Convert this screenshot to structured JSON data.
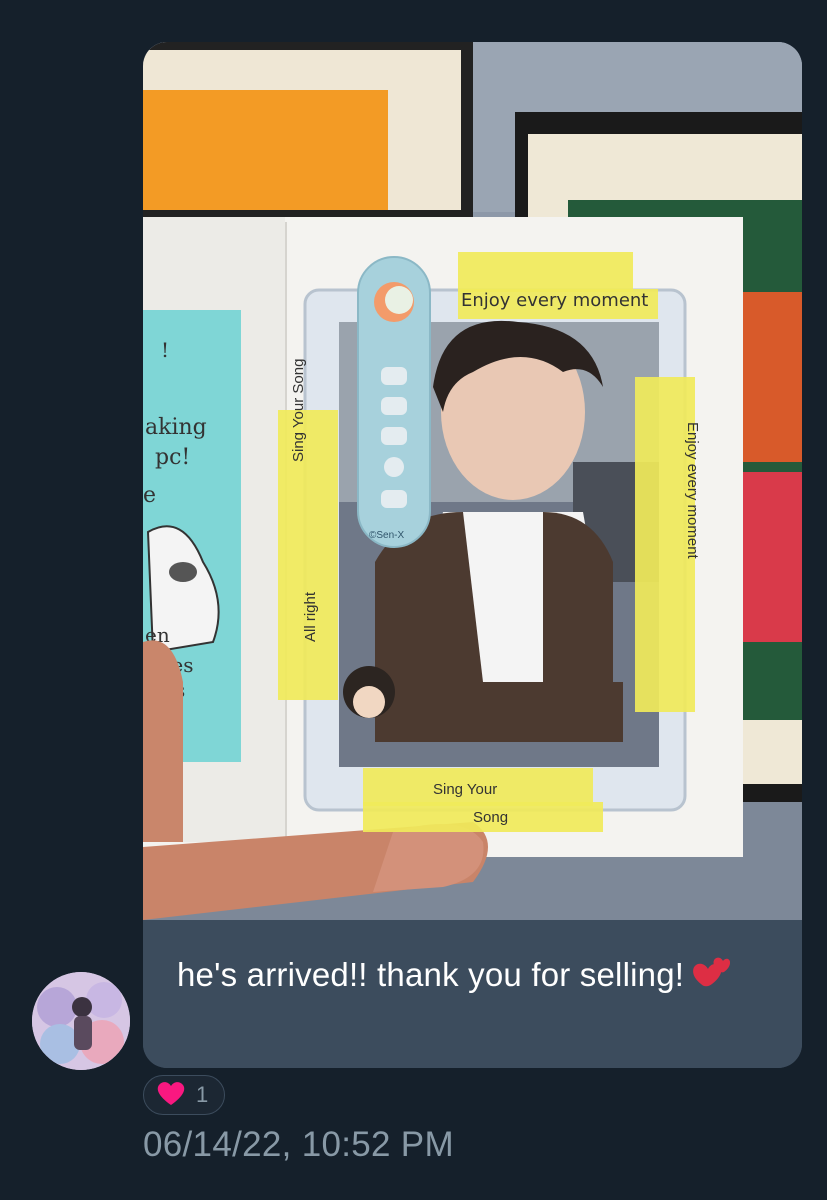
{
  "message": {
    "caption": "he's arrived!! thank you for selling!",
    "caption_emoji": "two-hearts-icon",
    "photo": {
      "tape_texts": [
        "Enjoy every moment",
        "Sing Your Song",
        "All right",
        "Enjoy every moment",
        "Sing Your Song"
      ],
      "sticker_mark": "©Sen-X",
      "note_text": [
        "aking",
        "pc!",
        "e",
        "en",
        "les",
        "s"
      ]
    },
    "reaction": {
      "icon": "heart-icon",
      "count": "1",
      "color": "#f91880"
    },
    "timestamp": "06/14/22, 10:52 PM"
  },
  "colors": {
    "background": "#15202b",
    "bubble": "#3c4c5d",
    "text_primary": "#ffffff",
    "text_secondary": "#8899a6",
    "tape": "#f0ea5a",
    "note": "#7fd6d6"
  }
}
